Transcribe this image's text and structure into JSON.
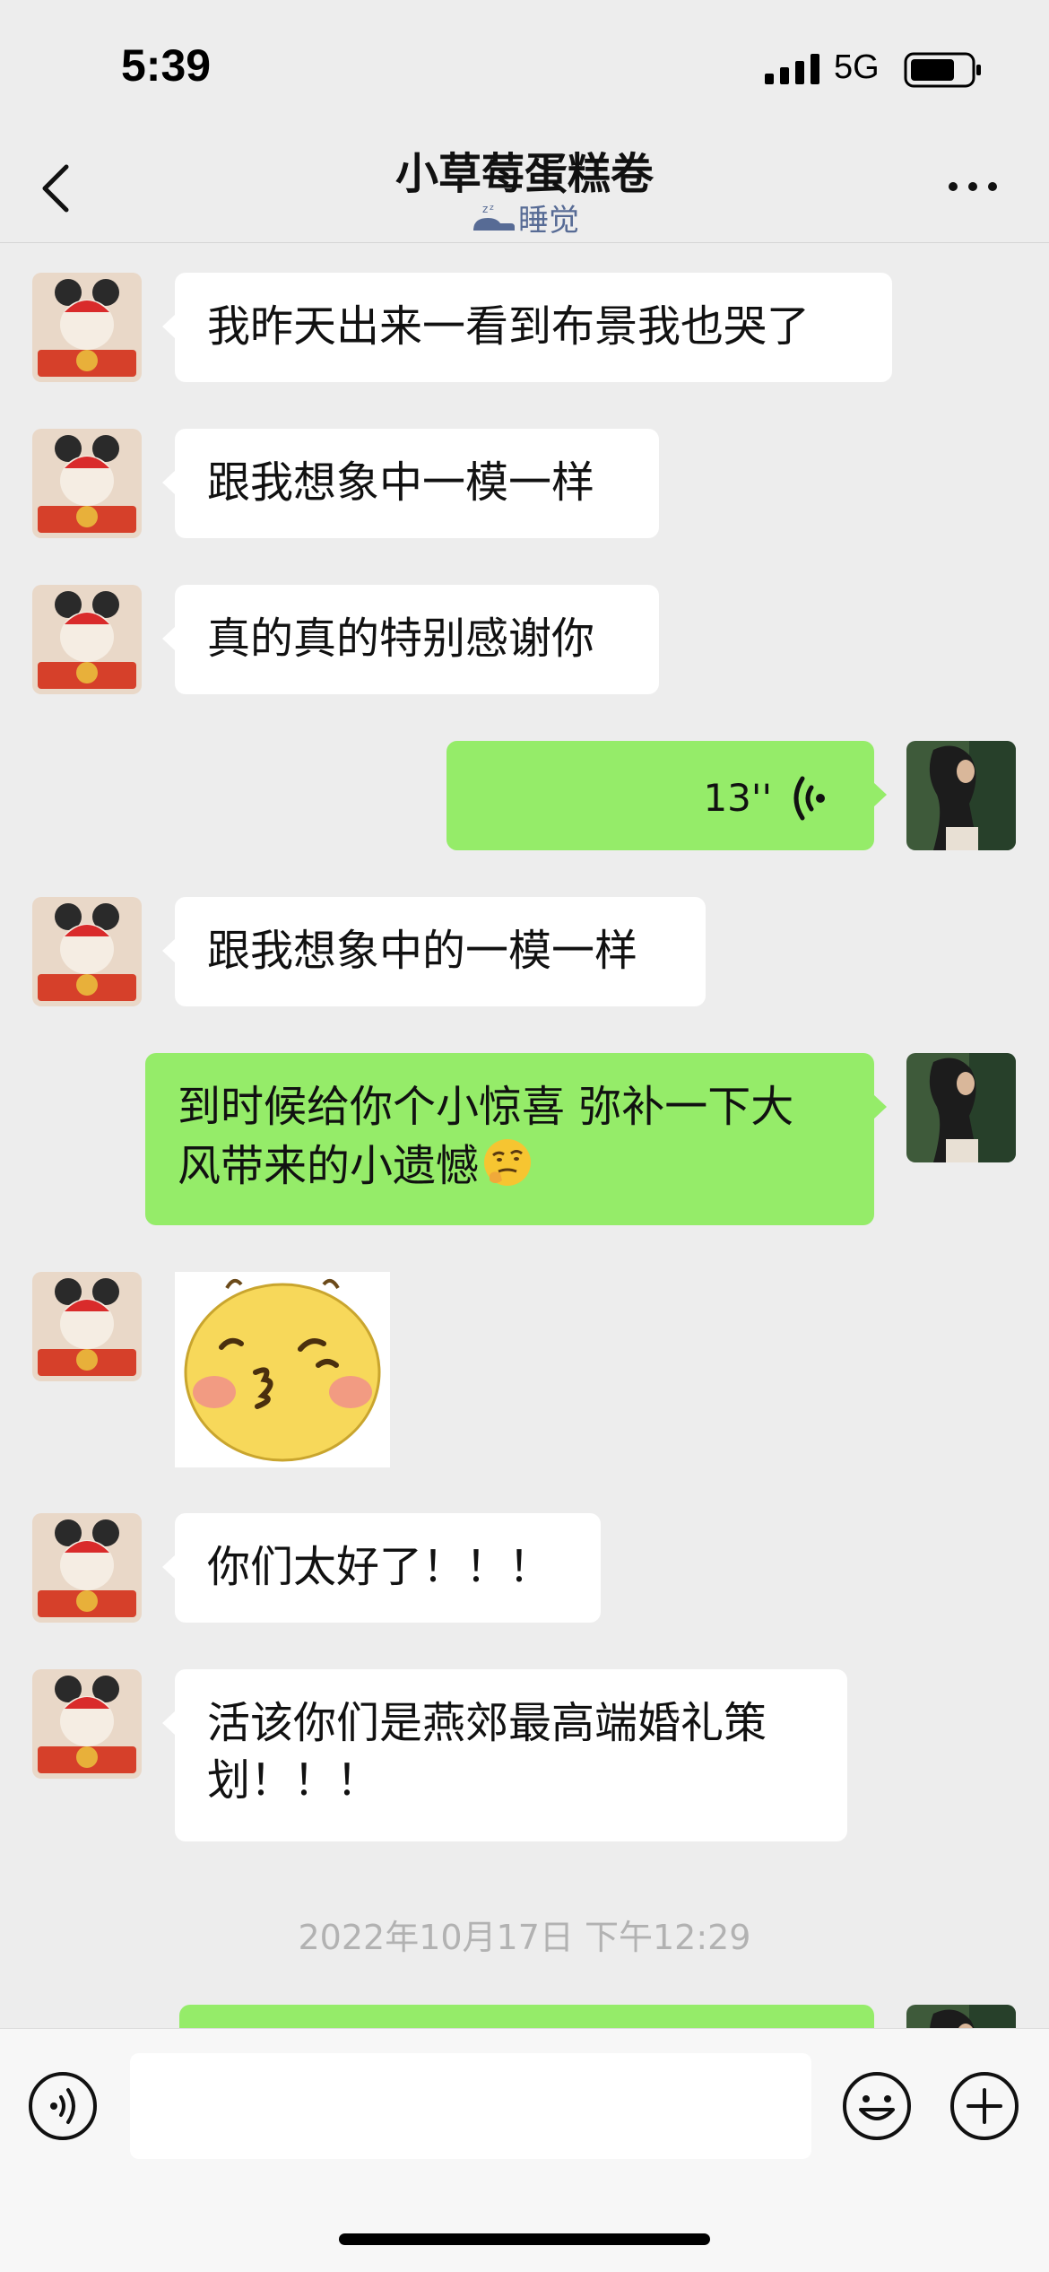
{
  "status_bar": {
    "time": "5:39",
    "network": "5G"
  },
  "header": {
    "title": "小草莓蛋糕卷",
    "status": "睡觉"
  },
  "messages": [
    {
      "text": "我昨天出来一看到布景我也哭了"
    },
    {
      "text": "跟我想象中一模一样"
    },
    {
      "text": "真的真的特别感谢你"
    },
    {
      "voice_duration": "13''"
    },
    {
      "text": "跟我想象中的一模一样"
    },
    {
      "line1": "到时候给你个小惊喜 弥补一下大",
      "line2": "风带来的小遗憾"
    },
    {
      "sticker": "kissing-face-sticker"
    },
    {
      "text": "你们太好了！！！"
    },
    {
      "line1": "活该你们是燕郊最高端婚礼策",
      "line2": "划！！！"
    }
  ],
  "timestamp": "2022年10月17日 下午12:29",
  "input": {
    "value": "",
    "placeholder": ""
  },
  "colors": {
    "background": "#ededed",
    "sent_bubble": "#95ec69",
    "received_bubble": "#ffffff",
    "status_link": "#576b95"
  }
}
